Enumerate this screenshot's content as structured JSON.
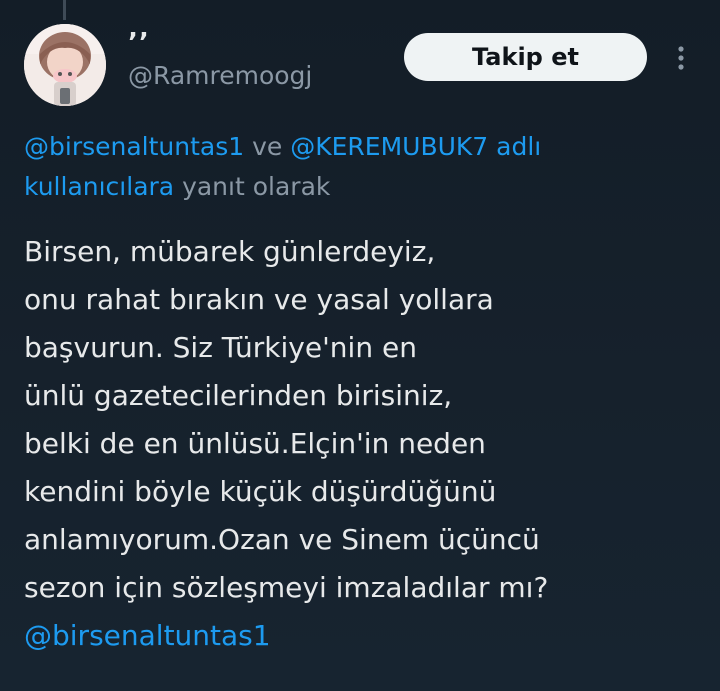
{
  "author": {
    "display_name": "’’",
    "handle": "@Ramremoogj",
    "avatar_icon": "avatar-photo-icon"
  },
  "actions": {
    "follow_label": "Takip et",
    "more_icon": "more-vertical-icon"
  },
  "reply_context": {
    "mention_1": "@birsenaltuntas1",
    "connector": " ve ",
    "mention_2": "@KEREMUBUK7",
    "suffix_1": " adlı",
    "mention_suffix_2": "kullanıcılara",
    "suffix_2": " yanıt olarak"
  },
  "tweet": {
    "lines": [
      "Birsen, mübarek günlerdeyiz,",
      "onu rahat bırakın ve yasal yollara",
      "başvurun. Siz Türkiye'nin en",
      "ünlü gazetecilerinden birisiniz,",
      "belki de en ünlüsü.Elçin'in neden",
      "kendini böyle küçük düşürdüğünü",
      "anlamıyorum.Ozan ve Sinem üçüncü",
      "sezon için sözleşmeyi imzaladılar mı?"
    ],
    "trailing_mention": "@birsenaltuntas1"
  },
  "colors": {
    "background": "#15202b",
    "text": "#e7e9ea",
    "secondary_text": "#8b98a5",
    "link": "#1d9bf0",
    "button_bg": "#eff3f4"
  }
}
